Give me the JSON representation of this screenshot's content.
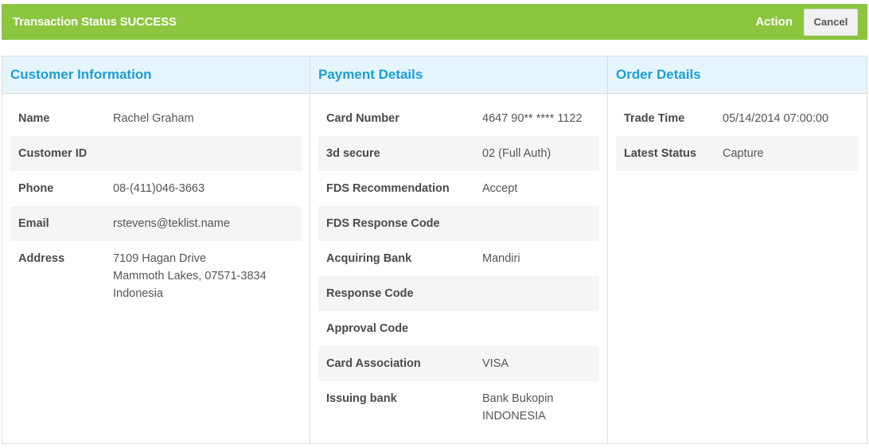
{
  "header": {
    "title": "Transaction Status SUCCESS",
    "action_label": "Action",
    "cancel_label": "Cancel"
  },
  "customer": {
    "heading": "Customer Information",
    "rows": [
      {
        "label": "Name",
        "value": "Rachel Graham"
      },
      {
        "label": "Customer ID",
        "value": ""
      },
      {
        "label": "Phone",
        "value": "08-(411)046-3663"
      },
      {
        "label": "Email",
        "value": "rstevens@teklist.name"
      },
      {
        "label": "Address",
        "value": "7109 Hagan Drive\nMammoth Lakes, 07571-3834\nIndonesia"
      }
    ]
  },
  "payment": {
    "heading": "Payment Details",
    "rows": [
      {
        "label": "Card Number",
        "value": "4647 90** **** 1122"
      },
      {
        "label": "3d secure",
        "value": "02 (Full Auth)"
      },
      {
        "label": "FDS Recommendation",
        "value": "Accept"
      },
      {
        "label": "FDS Response Code",
        "value": ""
      },
      {
        "label": "Acquiring Bank",
        "value": "Mandiri"
      },
      {
        "label": "Response Code",
        "value": ""
      },
      {
        "label": "Approval Code",
        "value": ""
      },
      {
        "label": "Card Association",
        "value": "VISA"
      },
      {
        "label": "Issuing bank",
        "value": "Bank Bukopin\nINDONESIA"
      }
    ]
  },
  "order": {
    "heading": "Order Details",
    "rows": [
      {
        "label": "Trade Time",
        "value": "05/14/2014 07:00:00"
      },
      {
        "label": "Latest Status",
        "value": "Capture"
      }
    ]
  },
  "colors": {
    "header_bg": "#8cc63f",
    "panel_head_bg": "#e6f5fc",
    "panel_head_text": "#1a9fd5"
  }
}
